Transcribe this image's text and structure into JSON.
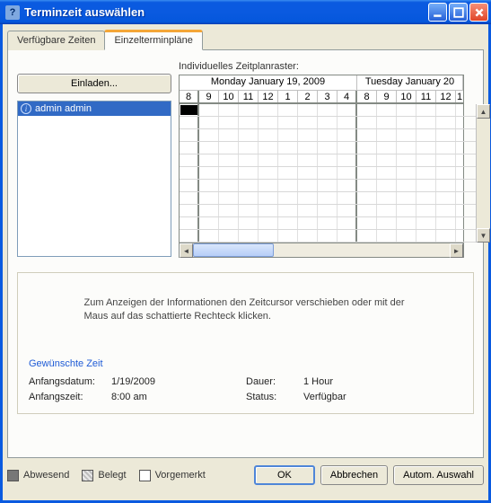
{
  "window": {
    "title": "Terminzeit auswählen"
  },
  "tabs": {
    "available": "Verfügbare Zeiten",
    "individual": "Einzelterminpläne"
  },
  "invite_label": "Einladen...",
  "attendees": [
    "admin admin"
  ],
  "grid": {
    "label": "Individuelles Zeitplanraster:",
    "days": [
      "Monday January 19, 2009",
      "Tuesday January 20"
    ],
    "hours_day1": [
      "8",
      "9",
      "10",
      "11",
      "12",
      "1",
      "2",
      "3",
      "4"
    ],
    "hours_day2": [
      "8",
      "9",
      "10",
      "11",
      "12",
      "1"
    ]
  },
  "info": {
    "hint": "Zum Anzeigen der Informationen den Zeitcursor verschieben oder mit der Maus auf das schattierte Rechteck klicken.",
    "desired_title": "Gewünschte Zeit",
    "start_date_label": "Anfangsdatum:",
    "start_date_value": "1/19/2009",
    "start_time_label": "Anfangszeit:",
    "start_time_value": "8:00 am",
    "duration_label": "Dauer:",
    "duration_value": "1 Hour",
    "status_label": "Status:",
    "status_value": "Verfügbar"
  },
  "legend": {
    "absent": "Abwesend",
    "busy": "Belegt",
    "tentative": "Vorgemerkt"
  },
  "buttons": {
    "ok": "OK",
    "cancel": "Abbrechen",
    "auto": "Autom. Auswahl"
  }
}
